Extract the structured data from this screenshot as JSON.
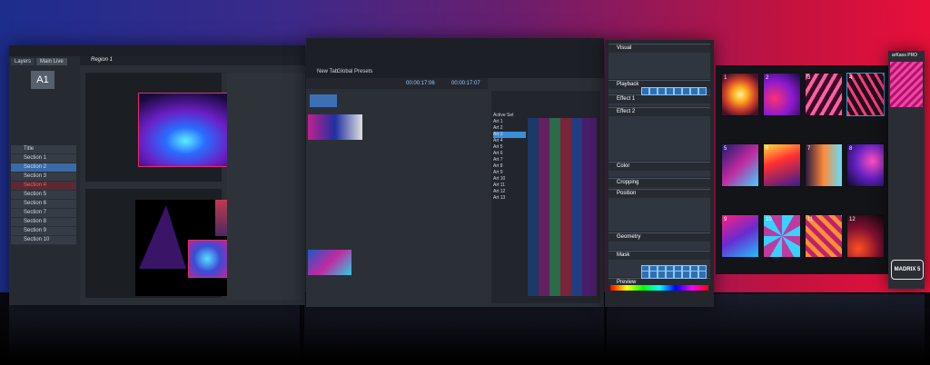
{
  "left_window": {
    "tabs": [
      "Layers",
      "Main Live"
    ],
    "path": "Region 1",
    "preview_label": "A1",
    "list_items": [
      "Title",
      "Section 1",
      "Section 2",
      "Section 3",
      "Section 4",
      "Section 5",
      "Section 6",
      "Section 7",
      "Section 8",
      "Section 9",
      "Section 10"
    ]
  },
  "middle_window": {
    "toolbar": [
      "New Tab",
      "Global Presets"
    ],
    "timecode_a": "00:00:17:06",
    "timecode_b": "00:00:17:07",
    "browser_items": [
      "Active Set",
      "Art 1",
      "Art 2",
      "Art 3",
      "Art 4",
      "Art 5",
      "Art 6",
      "Art 7",
      "Art 8",
      "Art 9",
      "Art 10",
      "Art 11",
      "Art 12",
      "Art 13"
    ]
  },
  "right_panel": {
    "sections": [
      "Visual",
      "Playback",
      "Effect 1",
      "Effect 2",
      "Color",
      "Cropping",
      "Position",
      "Geometry",
      "Mask",
      "Preview"
    ]
  },
  "media_grid": {
    "numbers": [
      "1",
      "2",
      "3",
      "4",
      "5",
      "6",
      "7",
      "8",
      "9",
      "10",
      "11",
      "12"
    ]
  },
  "brand": {
    "logo_text": "MADRIX 5",
    "badge": "arKaos PRO"
  },
  "colors": {
    "accent": "#3b8fd8",
    "panel": "#2a2f36",
    "background_left": "#1d2d8c",
    "background_right": "#e8103a"
  }
}
